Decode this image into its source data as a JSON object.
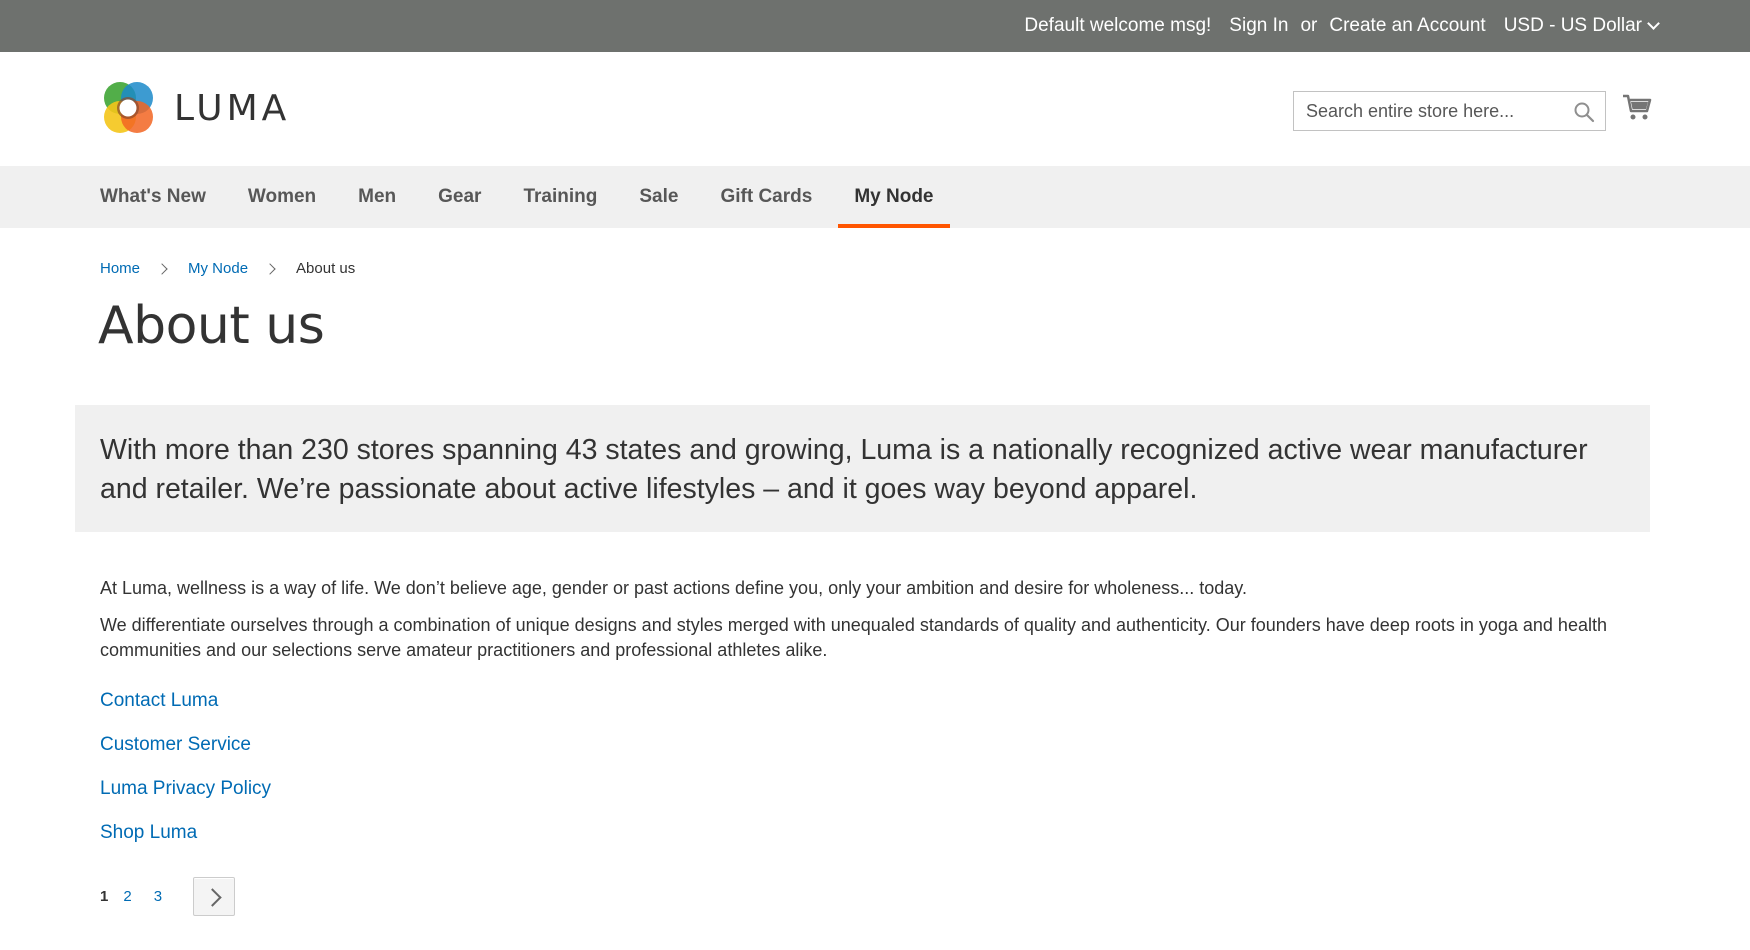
{
  "panel": {
    "welcome": "Default welcome msg!",
    "sign_in": "Sign In",
    "or": "or",
    "create_account": "Create an Account",
    "currency": "USD - US Dollar"
  },
  "header": {
    "logo_text": "LUMA",
    "search_placeholder": "Search entire store here..."
  },
  "nav": {
    "items": [
      {
        "label": "What's New"
      },
      {
        "label": "Women"
      },
      {
        "label": "Men"
      },
      {
        "label": "Gear"
      },
      {
        "label": "Training"
      },
      {
        "label": "Sale"
      },
      {
        "label": "Gift Cards"
      },
      {
        "label": "My Node",
        "active": true
      }
    ]
  },
  "breadcrumbs": [
    "Home",
    "My Node",
    "About us"
  ],
  "page_title": "About us",
  "intro": "With more than 230 stores spanning 43 states and growing, Luma is a nationally recognized active wear manufacturer and retailer. We’re passionate about active lifestyles – and it goes way beyond apparel.",
  "paragraphs": [
    "At Luma, wellness is a way of life. We don’t believe age, gender or past actions define you, only your ambition and desire for wholeness... today.",
    "We differentiate ourselves through a combination of unique designs and styles merged with unequaled standards of quality and authenticity. Our founders have deep roots in yoga and health communities and our selections serve amateur practitioners and professional athletes alike."
  ],
  "links": [
    "Contact Luma",
    "Customer Service",
    "Luma Privacy Policy",
    "Shop Luma"
  ],
  "pager": {
    "pages": [
      "1",
      "2",
      "3"
    ],
    "current": "1"
  },
  "colors": {
    "panel_bg": "#6e716e",
    "nav_bg": "#f0f0f0",
    "accent": "#ff5501",
    "link": "#006bb4"
  }
}
